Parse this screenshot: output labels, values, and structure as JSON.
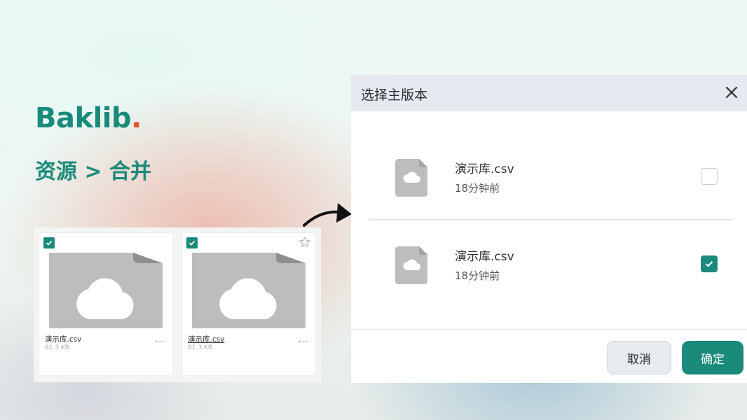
{
  "brand": {
    "name": "Baklib",
    "dot": "."
  },
  "breadcrumb": "资源 > 合并",
  "grid": {
    "cards": [
      {
        "name": "演示库.csv",
        "size": "81.3 KB",
        "more": "···",
        "checked": true,
        "starred": false
      },
      {
        "name": "演示库.csv",
        "size": "81.3 KB",
        "more": "···",
        "checked": true,
        "starred": true
      }
    ]
  },
  "dialog": {
    "title": "选择主版本",
    "items": [
      {
        "name": "演示库.csv",
        "time": "18分钟前",
        "checked": false
      },
      {
        "name": "演示库.csv",
        "time": "18分钟前",
        "checked": true
      }
    ],
    "cancel_label": "取消",
    "ok_label": "确定"
  },
  "colors": {
    "accent": "#1a8a7a",
    "brand_dot": "#e2531e"
  }
}
